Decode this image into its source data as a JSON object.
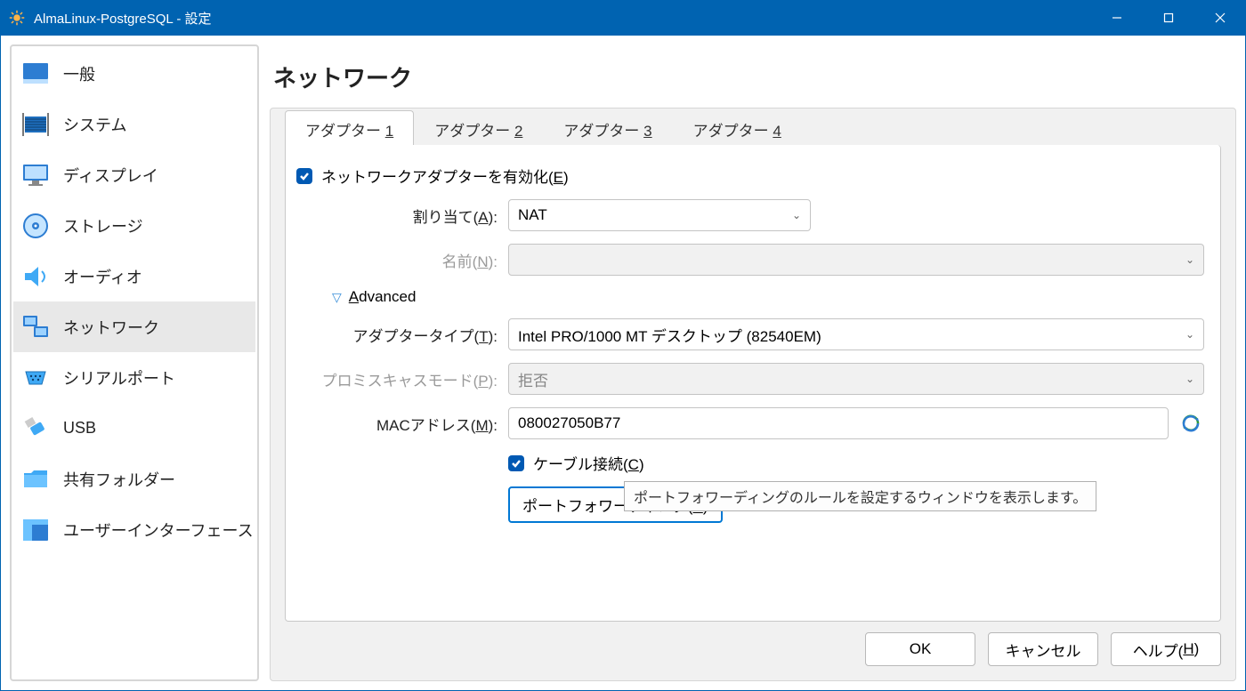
{
  "window": {
    "title": "AlmaLinux-PostgreSQL - 設定"
  },
  "sidebar": {
    "items": [
      {
        "label": "一般"
      },
      {
        "label": "システム"
      },
      {
        "label": "ディスプレイ"
      },
      {
        "label": "ストレージ"
      },
      {
        "label": "オーディオ"
      },
      {
        "label": "ネットワーク"
      },
      {
        "label": "シリアルポート"
      },
      {
        "label": "USB"
      },
      {
        "label": "共有フォルダー"
      },
      {
        "label": "ユーザーインターフェース"
      }
    ]
  },
  "main": {
    "title": "ネットワーク",
    "tabs": {
      "prefix": "アダプター ",
      "ids": [
        "1",
        "2",
        "3",
        "4"
      ]
    },
    "enable_label_pre": "ネットワークアダプターを有効化(",
    "enable_label_u": "E",
    "enable_label_post": ")",
    "attached_label_pre": "割り当て(",
    "attached_label_u": "A",
    "attached_label_post": "):",
    "attached_value": "NAT",
    "name_label_pre": "名前(",
    "name_label_u": "N",
    "name_label_post": "):",
    "advanced_label_pre": "A",
    "advanced_label_rest": "dvanced",
    "adapter_type_label_pre": "アダプタータイプ(",
    "adapter_type_label_u": "T",
    "adapter_type_label_post": "):",
    "adapter_type_value": "Intel PRO/1000 MT デスクトップ (82540EM)",
    "promisc_label_pre": "プロミスキャスモード(",
    "promisc_label_u": "P",
    "promisc_label_post": "):",
    "promisc_value": "拒否",
    "mac_label_pre": "MACアドレス(",
    "mac_label_u": "M",
    "mac_label_post": "):",
    "mac_value": "080027050B77",
    "cable_label_pre": "ケーブル接続(",
    "cable_label_u": "C",
    "cable_label_post": ")",
    "pf_label_pre": "ポートフォワーディング(",
    "pf_label_u": "P",
    "pf_label_post": ")",
    "tooltip": "ポートフォワーディングのルールを設定するウィンドウを表示します。"
  },
  "footer": {
    "ok": "OK",
    "cancel": "キャンセル",
    "help_pre": "ヘルプ(",
    "help_u": "H",
    "help_post": ")"
  }
}
